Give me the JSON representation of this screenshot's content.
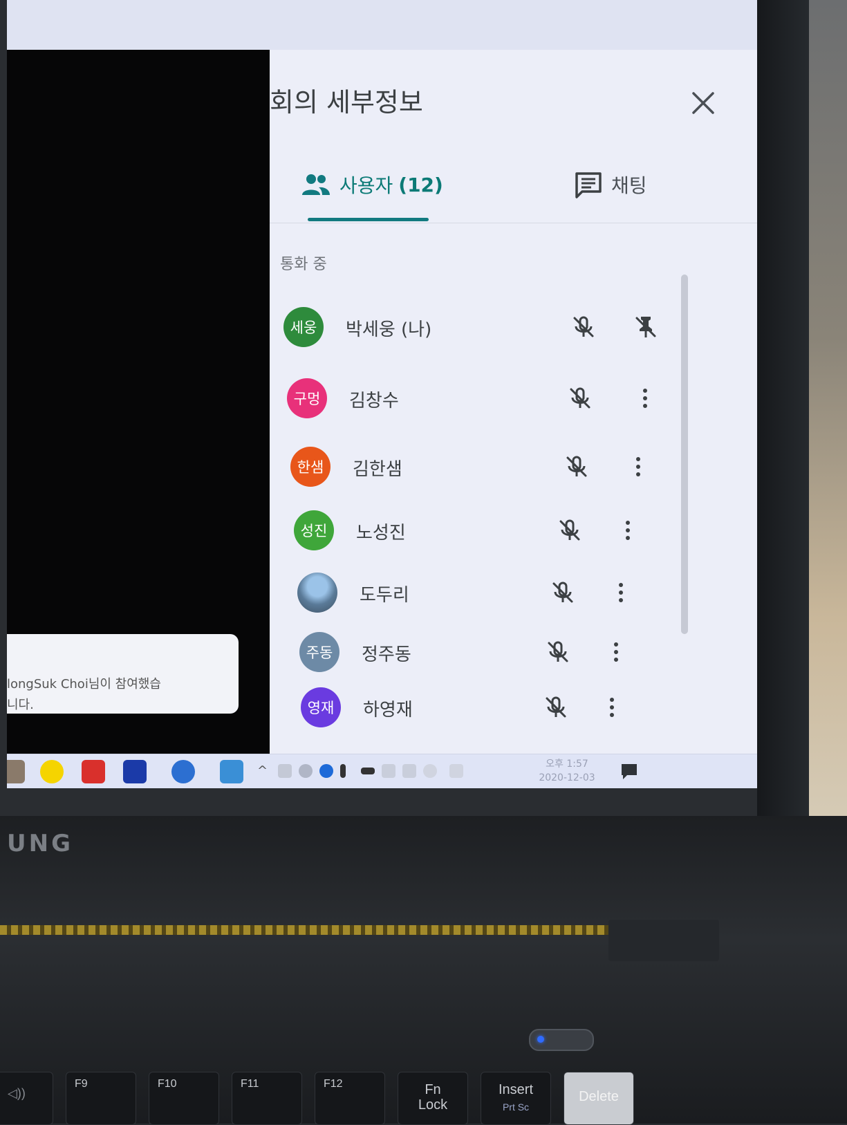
{
  "panel": {
    "title": "회의 세부정보",
    "tabs": [
      {
        "label": "사용자",
        "count": "(12)",
        "icon": "people-icon",
        "active": true
      },
      {
        "label": "채팅",
        "icon": "chat-icon",
        "active": false
      }
    ],
    "section_label": "통화 중",
    "participants": [
      {
        "initials": "세웅",
        "name": "박세웅 (나)",
        "avatar_color": "#2e8b3c",
        "action": "pin"
      },
      {
        "initials": "구멍",
        "name": "김창수",
        "avatar_color": "#e8317a",
        "action": "more"
      },
      {
        "initials": "한샘",
        "name": "김한샘",
        "avatar_color": "#e8561a",
        "action": "more"
      },
      {
        "initials": "성진",
        "name": "노성진",
        "avatar_color": "#3fa63a",
        "action": "more"
      },
      {
        "initials": "",
        "name": "도두리",
        "avatar_color": "photo",
        "action": "more"
      },
      {
        "initials": "주동",
        "name": "정주동",
        "avatar_color": "#6d8aa6",
        "action": "more"
      },
      {
        "initials": "영재",
        "name": "하영재",
        "avatar_color": "#6a3be0",
        "action": "more"
      }
    ]
  },
  "toast": {
    "text": "longSuk Choi님이 참여했습\n니다."
  },
  "taskbar": {
    "apps": [
      "home-icon",
      "kakaotalk-icon",
      "x-app-icon",
      "media-player-icon",
      "office-icon",
      "ruler-icon"
    ],
    "time": "오후 1:57",
    "date": "2020-12-03"
  },
  "laptop": {
    "brand": "UNG",
    "keys": [
      {
        "label": "",
        "sub": "◁))"
      },
      {
        "label": "F9",
        "sub": ""
      },
      {
        "label": "F10",
        "sub": ""
      },
      {
        "label": "F11",
        "sub": ""
      },
      {
        "label": "F12",
        "sub": ""
      },
      {
        "label": "Fn",
        "sub": "Lock"
      },
      {
        "label": "Insert",
        "sub": "Prt Sc"
      },
      {
        "label": "Delete",
        "sub": ""
      }
    ]
  },
  "colors": {
    "accent": "#127a80",
    "panel_bg": "#eceef8",
    "video_bg": "#060607"
  }
}
